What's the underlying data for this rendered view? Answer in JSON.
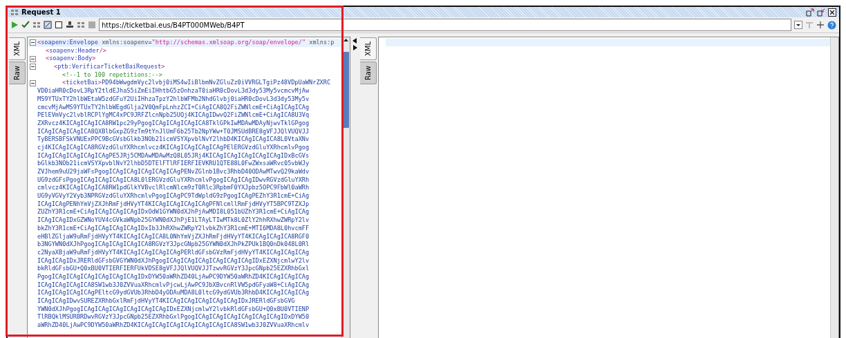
{
  "window": {
    "title": "Request 1"
  },
  "toolbar": {
    "url": "https://ticketbai.eus/B4PT000MWeb/B4PT"
  },
  "request_editor": {
    "tabs": [
      {
        "label": "XML",
        "selected": true
      },
      {
        "label": "Raw",
        "selected": false
      }
    ],
    "nodes": [
      {
        "fold": true,
        "tokens": [
          {
            "kind": "bracket",
            "text": "<"
          },
          {
            "kind": "tag",
            "text": "soapenv:Envelope"
          },
          {
            "kind": "attr",
            "text": " xmlns:soapenv"
          },
          {
            "kind": "punct",
            "text": "="
          },
          {
            "kind": "value",
            "text": "\"http://schemas.xmlsoap.org/soap/envelope/\""
          },
          {
            "kind": "attr",
            "text": " xmlns:p"
          }
        ],
        "children": [
          {
            "fold": false,
            "tokens": [
              {
                "kind": "bracket",
                "text": "<"
              },
              {
                "kind": "tag",
                "text": "soapenv:Header"
              },
              {
                "kind": "bracket",
                "text": "/>"
              }
            ]
          },
          {
            "fold": true,
            "tokens": [
              {
                "kind": "bracket",
                "text": "<"
              },
              {
                "kind": "tag",
                "text": "soapenv:Body"
              },
              {
                "kind": "bracket",
                "text": ">"
              }
            ],
            "children": [
              {
                "fold": true,
                "tokens": [
                  {
                    "kind": "bracket",
                    "text": "<"
                  },
                  {
                    "kind": "tag",
                    "text": "ptb:VerificarTicketBaiRequest"
                  },
                  {
                    "kind": "bracket",
                    "text": ">"
                  }
                ],
                "children": [
                  {
                    "fold": false,
                    "tokens": [
                      {
                        "kind": "comment",
                        "text": "<!--1 to 100 repetitions:-->"
                      }
                    ]
                  },
                  {
                    "fold": true,
                    "tokens": [
                      {
                        "kind": "bracket",
                        "text": "<"
                      },
                      {
                        "kind": "tag",
                        "text": "ticketBai"
                      },
                      {
                        "kind": "bracket",
                        "text": ">"
                      },
                      {
                        "kind": "text",
                        "text": "PD94bWwgdmVyc2lvbj0iMS4wIiBlbmNvZGluZz0iVVRGLTgiPz48VDpUaWNrZXRC"
                      }
                    ],
                    "content_lines": [
                      "VD0iaHR0cDovL3RpY2tldEJhaS5iZmEiIHhtbG5zOnhzaT0iaHR0cDovL3d3dy53My5vcmcvMjAw",
                      "MS9YTUxTY2hlbWEtaW5zdGFuY2UiIHhzaTpzY2hlbWFMb2NhdGlvbj0iaHR0cDovL3d3dy53My5v",
                      "cmcvMjAwMS9YTUxTY2hlbWEgdGlja2V0QmFpLnhzZCI+CiAgICA8Q2FiZWNlcmE+CiAgICAgICAg",
                      "PElEVmVyc2lvblRCPlYgMC4xPC9JRFZlcnNpb25UQj4KICAgIDwvQ2FiZWNlcmE+CiAgICA8U3Vq",
                      "ZXRvcz4KICAgICAgICA8RW1pc29yPgogICAgICAgICAgICA8TklGPkIwMDAwMDAyNjwvTklGPgog",
                      "ICAgICAgICAgICA8QXBlbGxpZG9zTm9tYnJlUmF6b25Tb2NpYWw+T0JMSUdBRE8gVFJJQlVUQVJJ",
                      "TyBERSBFSkVNUExPPC9BcGVsbGlkb3NOb21icmVSYXpvblNvY2lhbD4KICAgICAgICA8L0VtaXNv",
                      "cj4KICAgICAgICA8RGVzdGluYXRhcmlvcz4KICAgICAgICAgICAgPElERGVzdGluYXRhcmlvPgog",
                      "ICAgICAgICAgICAgICAgPE5JRj5CMDAwMDAwMzQ8L05JRj4KICAgICAgICAgICAgICAgIDxBcGVs",
                      "bGlkb3NOb21icmVSYXpvblNvY2lhbD5DTElFTlRFIERFIEVKRU1QTE88L0FwZWxsaWRvc05vbWJy",
                      "ZVJhem9uU29jaWFsPgogICAgICAgICAgICAgICAgPENvZGlnb1Bvc3RhbD40ODAwMTwvQ29kaWdv",
                      "UG9zdGFsPgogICAgICAgICAgICA8L0lERGVzdGluYXRhcmlvPgogICAgICAgIDwvRGVzdGluYXRh",
                      "cmlvcz4KICAgICAgICA8RW1pdGlkYVBvclRlcmNlcm9zT0Rlc3RpbmF0YXJpbz5OPC9FbWl0aWRh",
                      "UG9yVGVyY2Vyb3NPRGVzdGluYXRhcmlvPgogICAgPC9TdWpldG9zPgogICAgPEZhY3R1cmE+CiAg",
                      "ICAgICAgPENhYmVjZXJhRmFjdHVyYT4KICAgICAgICAgICAgPFNlcmllRmFjdHVyYT5BPC9TZXJp",
                      "ZUZhY3R1cmE+CiAgICAgICAgICAgIDxOdW1GYWN0dXJhPjAwMDI8L051bUZhY3R1cmE+CiAgICAg",
                      "ICAgICAgIDxGZWNoYUV4cGVkaWNpb25GYWN0dXJhPjE1LTAyLTIwMTk8L0ZlY2hhRXhwZWRpY2lv",
                      "bkZhY3R1cmE+CiAgICAgICAgICAgIDxIb3JhRXhwZWRpY2lvbkZhY3R1cmE+MTI6MDA8L0hvcmFF",
                      "eHBlZGljaW9uRmFjdHVyYT4KICAgICAgICA8L0NhYmVjZXJhRmFjdHVyYT4KICAgICAgICA8RGF0",
                      "b3NGYWN0dXJhPgogICAgICAgICAgICA8RGVzY3JpcGNpb25GYWN0dXJhPkZPUk1BQ0nDk048L0Rl",
                      "c2NyaXBjaW9uRmFjdHVyYT4KICAgICAgICAgICAgPERldGFsbGVzRmFjdHVyYT4KICAgICAgICAg",
                      "ICAgICAgIDxJRERldGFsbGVGYWN0dXJhPgogICAgICAgICAgICAgICAgICAgIDxEZXNjcmlwY2lv",
                      "bkRldGFsbGU+Q0xBU0VTIERFIERFUkVDSE8gVFJJQlVUQVJJTzwvRGVzY3JpcGNpb25EZXRhbGxl",
                      "PgogICAgICAgICAgICAgICAgICAgIDxDYW50aWRhZD40LjAwPC9DYW50aWRhZD4KICAgICAgICAg",
                      "ICAgICAgICAgICA8SW1wb3J0ZVVuaXRhcmlvPjcwLjAwPC9JbXBvcnRlVW5pdGFyaW8+CiAgICAg",
                      "ICAgICAgICAgICAgPEltcG9ydGVUb3RhbD4yODAuMDA8L0ltcG9ydGVUb3RhbD4KICAgICAgICAg",
                      "ICAgICAgIDwvSUREZXRhbGxlRmFjdHVyYT4KICAgICAgICAgICAgICAgIDxJRERldGFsbGVG",
                      "YWN0dXJhPgogICAgICAgICAgICAgICAgICAgIDxEZXNjcmlwY2lvbkRldGFsbGU+Q0xBU0VTIENP",
                      "TlRBQklMSURBRDwvRGVzY3JpcGNpb25EZXRhbGxlPgogICAgICAgICAgICAgICAgICAgIDxDYW50",
                      "aWRhZD40LjAwPC9DYW50aWRhZD4KICAgICAgICAgICAgICAgICAgICA8SW1wb3J0ZVVuaXRhcmlv"
                    ]
                  }
                ]
              }
            ]
          }
        ]
      }
    ]
  },
  "response_editor": {
    "tabs": [
      {
        "label": "XML",
        "selected": true
      },
      {
        "label": "Raw",
        "selected": false
      }
    ]
  }
}
